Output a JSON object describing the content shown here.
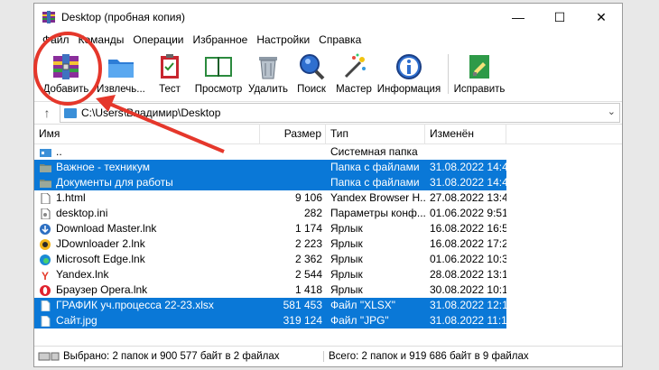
{
  "window": {
    "title": "Desktop (пробная копия)"
  },
  "menu": [
    "Файл",
    "Команды",
    "Операции",
    "Избранное",
    "Настройки",
    "Справка"
  ],
  "toolbar": [
    {
      "label": "Добавить",
      "icon": "winrar-add-icon"
    },
    {
      "label": "Извлечь...",
      "icon": "extract-folder-icon"
    },
    {
      "label": "Тест",
      "icon": "test-clipboard-icon"
    },
    {
      "label": "Просмотр",
      "icon": "view-book-icon"
    },
    {
      "label": "Удалить",
      "icon": "trash-icon"
    },
    {
      "label": "Поиск",
      "icon": "search-icon"
    },
    {
      "label": "Мастер",
      "icon": "wizard-wand-icon"
    },
    {
      "label": "Информация",
      "icon": "info-icon"
    },
    {
      "label": "Исправить",
      "icon": "repair-icon"
    }
  ],
  "path": "C:\\Users\\Владимир\\Desktop",
  "columns": {
    "name": "Имя",
    "size": "Размер",
    "type": "Тип",
    "modified": "Изменён"
  },
  "files": [
    {
      "name": "..",
      "size": "",
      "type": "Системная папка",
      "modified": "",
      "icon": "up-folder-icon",
      "selected": false
    },
    {
      "name": "Важное - техникум",
      "size": "",
      "type": "Папка с файлами",
      "modified": "31.08.2022 14:41",
      "icon": "folder-icon",
      "selected": true
    },
    {
      "name": "Документы для работы",
      "size": "",
      "type": "Папка с файлами",
      "modified": "31.08.2022 14:41",
      "icon": "folder-icon",
      "selected": true
    },
    {
      "name": "1.html",
      "size": "9 106",
      "type": "Yandex Browser H...",
      "modified": "27.08.2022 13:41",
      "icon": "html-file-icon",
      "selected": false
    },
    {
      "name": "desktop.ini",
      "size": "282",
      "type": "Параметры конф...",
      "modified": "01.06.2022 9:51",
      "icon": "settings-file-icon",
      "selected": false
    },
    {
      "name": "Download Master.lnk",
      "size": "1 174",
      "type": "Ярлык",
      "modified": "16.08.2022 16:57",
      "icon": "download-master-icon",
      "selected": false
    },
    {
      "name": "JDownloader 2.lnk",
      "size": "2 223",
      "type": "Ярлык",
      "modified": "16.08.2022 17:21",
      "icon": "jdownloader-icon",
      "selected": false
    },
    {
      "name": "Microsoft Edge.lnk",
      "size": "2 362",
      "type": "Ярлык",
      "modified": "01.06.2022 10:33",
      "icon": "edge-icon",
      "selected": false
    },
    {
      "name": "Yandex.lnk",
      "size": "2 544",
      "type": "Ярлык",
      "modified": "28.08.2022 13:16",
      "icon": "yandex-icon",
      "selected": false
    },
    {
      "name": "Браузер Opera.lnk",
      "size": "1 418",
      "type": "Ярлык",
      "modified": "30.08.2022 10:14",
      "icon": "opera-icon",
      "selected": false
    },
    {
      "name": "ГРАФИК уч.процесса 22-23.xlsx",
      "size": "581 453",
      "type": "Файл \"XLSX\"",
      "modified": "31.08.2022 12:14",
      "icon": "xlsx-file-icon",
      "selected": true
    },
    {
      "name": "Сайт.jpg",
      "size": "319 124",
      "type": "Файл \"JPG\"",
      "modified": "31.08.2022 11:18",
      "icon": "jpg-file-icon",
      "selected": true
    }
  ],
  "status": {
    "left": "Выбрано: 2 папок и 900 577 байт в 2 файлах",
    "right": "Всего: 2 папок и 919 686 байт в 9 файлах"
  },
  "colors": {
    "selection": "#0a78d7",
    "annotation": "#e5372b"
  }
}
